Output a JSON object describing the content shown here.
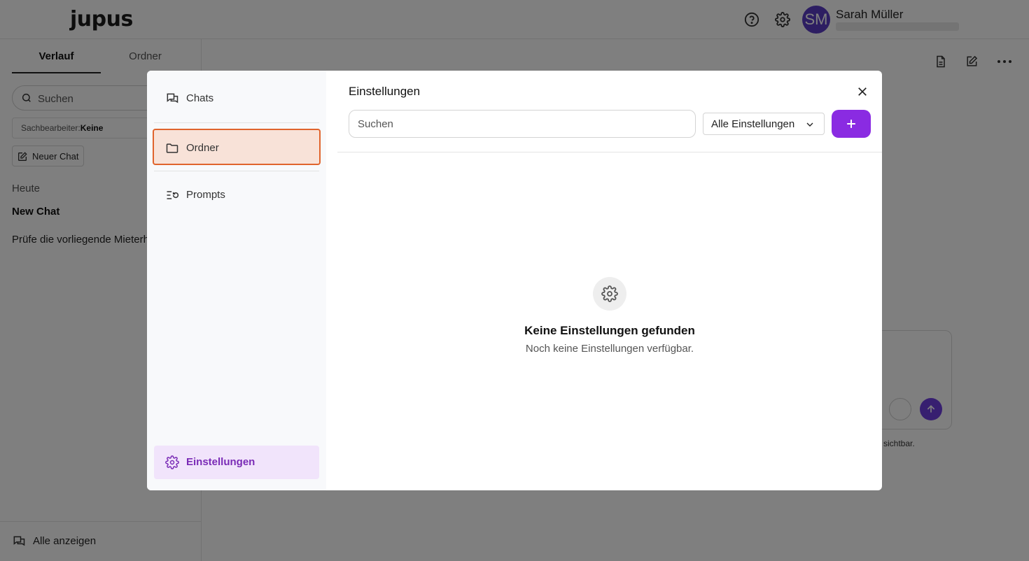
{
  "app": {
    "logo": "jupus",
    "user": {
      "initials": "SM",
      "name": "Sarah Müller"
    }
  },
  "sidebar": {
    "tabs": [
      "Verlauf",
      "Ordner"
    ],
    "search_placeholder": "Suchen",
    "filter_label": "Sachbearbeiter:",
    "filter_value": "Keine",
    "new_chat": "Neuer Chat",
    "section_today": "Heute",
    "items": [
      "New Chat",
      "Prüfe die vorliegende Mieterh"
    ],
    "show_all": "Alle anzeigen"
  },
  "main": {
    "footnote": "sichtbar."
  },
  "modal": {
    "nav": {
      "chats": "Chats",
      "folders": "Ordner",
      "prompts": "Prompts",
      "settings": "Einstellungen"
    },
    "title": "Einstellungen",
    "search_placeholder": "Suchen",
    "filter_selected": "Alle Einstellungen",
    "empty_title": "Keine Einstellungen gefunden",
    "empty_sub": "Noch keine Einstellungen verfügbar."
  },
  "colors": {
    "accent": "#8a2be2",
    "selected_border": "#e0642d",
    "selected_bg": "#f8e2d8",
    "avatar": "#5a3dc4"
  }
}
